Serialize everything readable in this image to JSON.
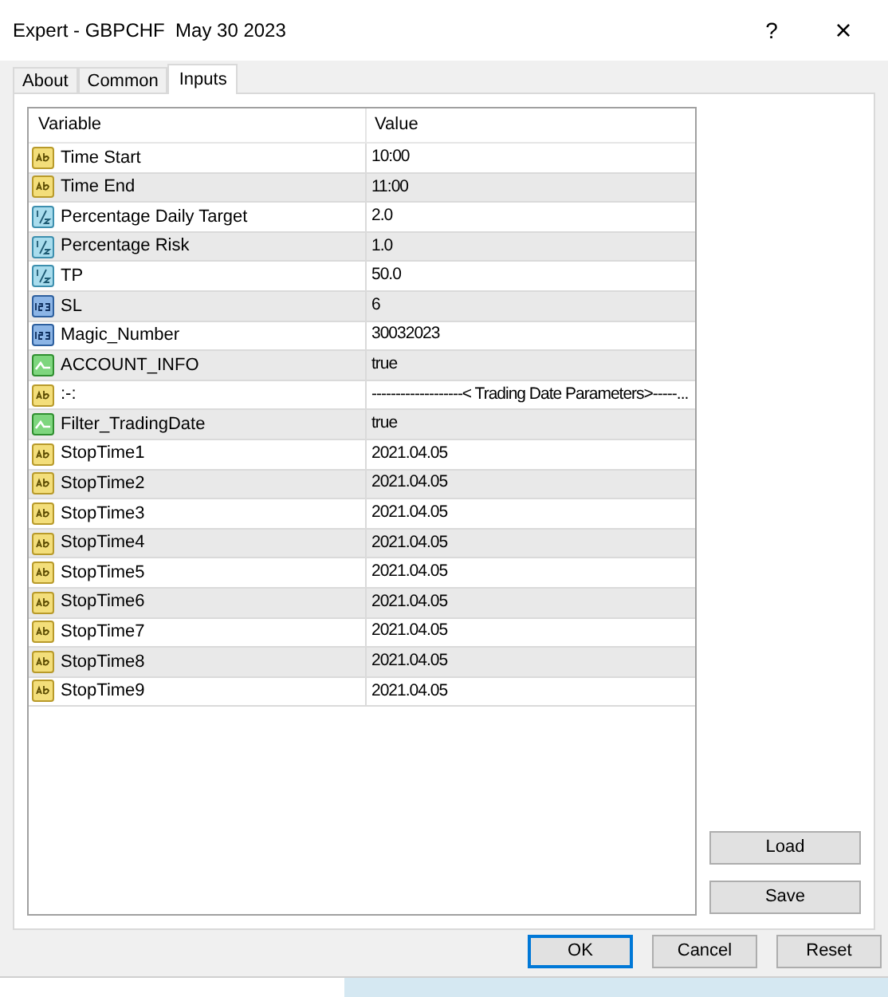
{
  "window": {
    "title": "Expert - GBPCHF  May 30 2023",
    "help": "?",
    "close": "×"
  },
  "tabs": [
    {
      "label": "About",
      "selected": false
    },
    {
      "label": "Common",
      "selected": false
    },
    {
      "label": "Inputs",
      "selected": true
    }
  ],
  "table": {
    "columns": [
      "Variable",
      "Value"
    ],
    "rows": [
      {
        "kind": "string",
        "variable": "Time Start",
        "value": "10:00"
      },
      {
        "kind": "string",
        "variable": "Time End",
        "value": "11:00"
      },
      {
        "kind": "double",
        "variable": "Percentage Daily Target",
        "value": "2.0"
      },
      {
        "kind": "double",
        "variable": "Percentage Risk",
        "value": "1.0"
      },
      {
        "kind": "double",
        "variable": "TP",
        "value": "50.0"
      },
      {
        "kind": "int",
        "variable": "SL",
        "value": "6"
      },
      {
        "kind": "int",
        "variable": "Magic_Number",
        "value": "30032023"
      },
      {
        "kind": "bool",
        "variable": "ACCOUNT_INFO",
        "value": "true"
      },
      {
        "kind": "string",
        "variable": ":-:",
        "value": "-------------------< Trading Date Parameters>-----..."
      },
      {
        "kind": "bool",
        "variable": "Filter_TradingDate",
        "value": "true"
      },
      {
        "kind": "string",
        "variable": "StopTime1",
        "value": "2021.04.05"
      },
      {
        "kind": "string",
        "variable": "StopTime2",
        "value": "2021.04.05"
      },
      {
        "kind": "string",
        "variable": "StopTime3",
        "value": "2021.04.05"
      },
      {
        "kind": "string",
        "variable": "StopTime4",
        "value": "2021.04.05"
      },
      {
        "kind": "string",
        "variable": "StopTime5",
        "value": "2021.04.05"
      },
      {
        "kind": "string",
        "variable": "StopTime6",
        "value": "2021.04.05"
      },
      {
        "kind": "string",
        "variable": "StopTime7",
        "value": "2021.04.05"
      },
      {
        "kind": "string",
        "variable": "StopTime8",
        "value": "2021.04.05"
      },
      {
        "kind": "string",
        "variable": "StopTime9",
        "value": "2021.04.05"
      }
    ]
  },
  "side_buttons": [
    "Load",
    "Save"
  ],
  "buttons": [
    {
      "label": "OK",
      "selected": true
    },
    {
      "label": "Cancel",
      "selected": false
    },
    {
      "label": "Reset",
      "selected": false
    }
  ]
}
